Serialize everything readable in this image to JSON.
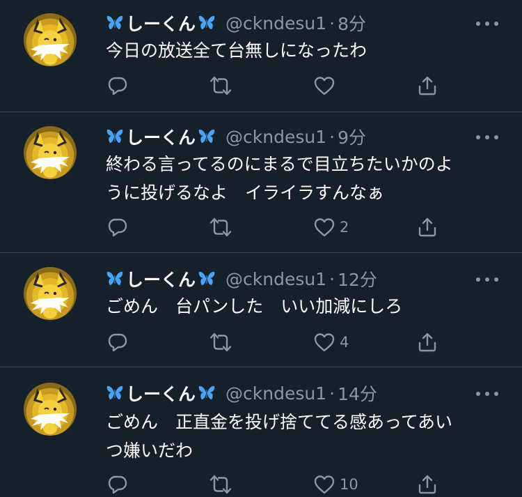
{
  "colors": {
    "background": "#15202b",
    "divider": "#38444d",
    "secondary_text": "#8899a6",
    "primary_text": "#ffffff",
    "butterfly": "#4aa3f5"
  },
  "icons": [
    "butterfly-icon",
    "reply-icon",
    "retweet-icon",
    "like-icon",
    "share-icon",
    "more-icon"
  ],
  "tweets": [
    {
      "display_name": "しーくん",
      "handle": "@ckndesu1",
      "separator": "·",
      "time": "8分",
      "text": "今日の放送全て台無しになったわ",
      "like_count": ""
    },
    {
      "display_name": "しーくん",
      "handle": "@ckndesu1",
      "separator": "·",
      "time": "9分",
      "text": "終わる言ってるのにまるで目立ちたいかのよ\nうに投げるなよ　イライラすんなぁ",
      "like_count": "2"
    },
    {
      "display_name": "しーくん",
      "handle": "@ckndesu1",
      "separator": "·",
      "time": "12分",
      "text": "ごめん　台パンした　いい加減にしろ",
      "like_count": "4"
    },
    {
      "display_name": "しーくん",
      "handle": "@ckndesu1",
      "separator": "·",
      "time": "14分",
      "text": "ごめん　正直金を投げ捨ててる感あってあい\nつ嫌いだわ",
      "like_count": "10"
    }
  ]
}
